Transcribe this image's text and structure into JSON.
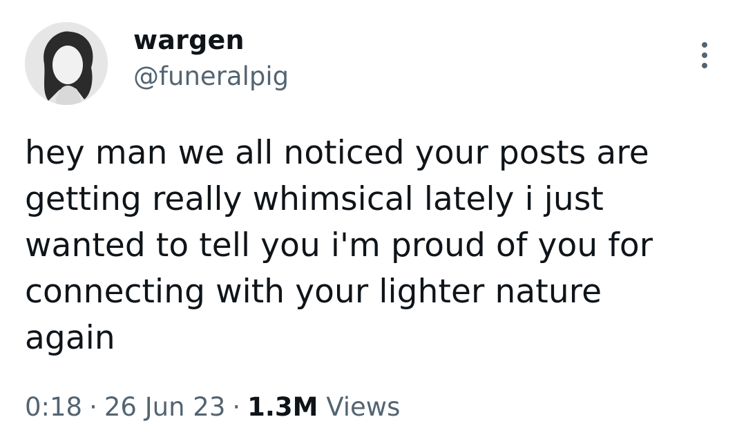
{
  "tweet": {
    "author": {
      "display_name": "wargen",
      "handle": "@funeralpig",
      "avatar_icon": "profile-photo"
    },
    "text": "hey man we all noticed your posts are\ngetting really whimsical lately i just\nwanted to tell you i'm proud of you for\nconnecting with your lighter nature\nagain",
    "time": "0:18",
    "date": "26 Jun 23",
    "separator": "·",
    "views_count": "1.3M",
    "views_label": "Views",
    "more_icon": "more-options-icon"
  },
  "colors": {
    "text_primary": "#0f1419",
    "text_secondary": "#536471",
    "background": "#ffffff"
  }
}
